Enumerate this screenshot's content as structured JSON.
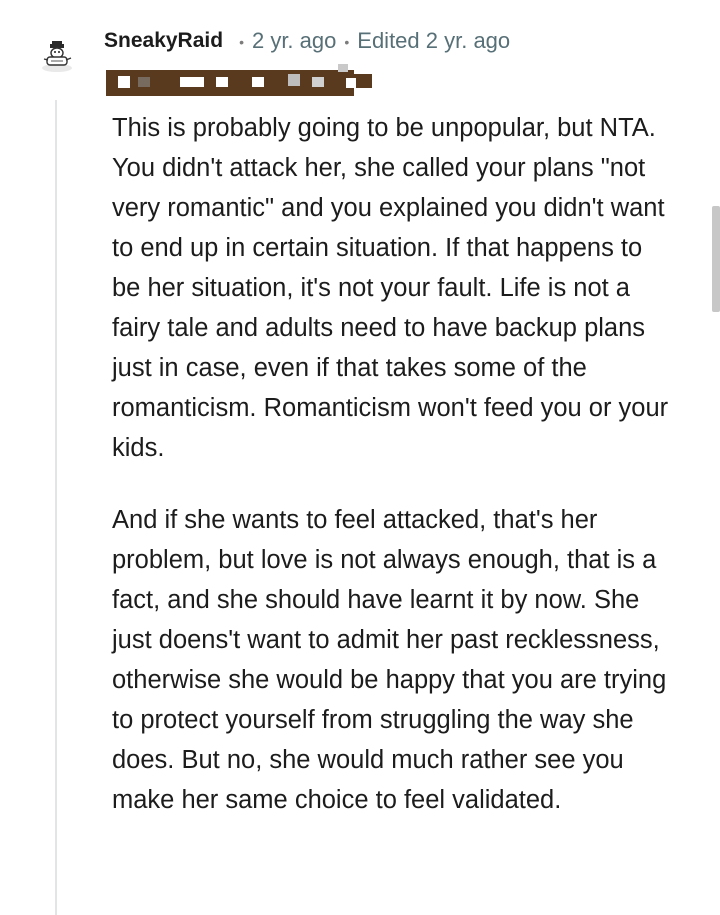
{
  "comment": {
    "username": "SneakyRaid",
    "posted": "2 yr. ago",
    "edited": "Edited 2 yr. ago",
    "separator": "•",
    "flair_redacted": true,
    "paragraphs": [
      "This is probably going to be unpopular, but NTA. You didn't attack her, she called your plans \"not very romantic\" and you explained you didn't want to end up in certain situation. If that happens to be her situation, it's not your fault. Life is not a fairy tale and adults need to have backup plans just in case, even if that takes some of the romanticism. Romanticism won't feed you or your kids.",
      "And if she wants to feel attacked, that's her problem, but love is not always enough, that is a fact, and she should have learnt it by now. She just doens't want to admit her past recklessness, otherwise she would be happy that you are trying to protect yourself from struggling the way she does. But no, she would much rather see you make her same choice to feel validated."
    ]
  },
  "icons": {
    "avatar": "user-avatar-icon"
  },
  "colors": {
    "text": "#1c1c1c",
    "meta": "#576f76",
    "thread_line": "#e2e4e6",
    "redaction": "#5a3a1e"
  }
}
